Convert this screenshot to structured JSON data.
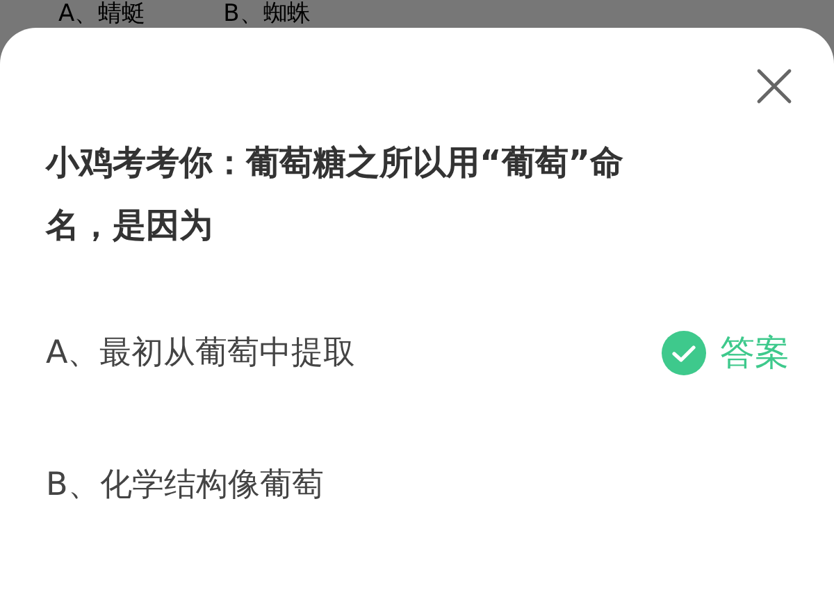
{
  "background_options": [
    "A、蜻蜓",
    "B、蜘蛛"
  ],
  "question": "小鸡考考你：葡萄糖之所以用“葡萄”命名，是因为",
  "options": [
    {
      "label": "A、最初从葡萄中提取",
      "answer": "答案"
    },
    {
      "label": "B、化学结构像葡萄"
    }
  ]
}
